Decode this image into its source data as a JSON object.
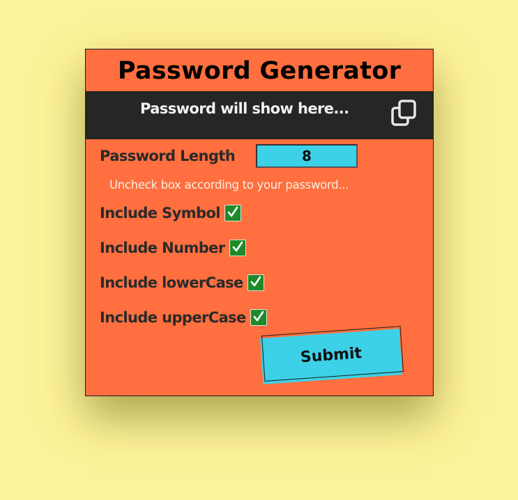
{
  "title": "Password Generator",
  "result": {
    "placeholder": "Password will show here...",
    "copy_icon": "copy-icon"
  },
  "length": {
    "label": "Password Length",
    "value": "8"
  },
  "hint": "Uncheck box according to your password...",
  "options": [
    {
      "label": "Include Symbol",
      "checked": true
    },
    {
      "label": "Include Number",
      "checked": true
    },
    {
      "label": "Include lowerCase",
      "checked": true
    },
    {
      "label": "Include upperCase",
      "checked": true
    }
  ],
  "submit_label": "Submit",
  "colors": {
    "page_bg": "#fdf39a",
    "card_bg": "#ff6f3f",
    "result_bg": "#262626",
    "accent": "#3dd1e7",
    "check": "#1f8a2a"
  }
}
